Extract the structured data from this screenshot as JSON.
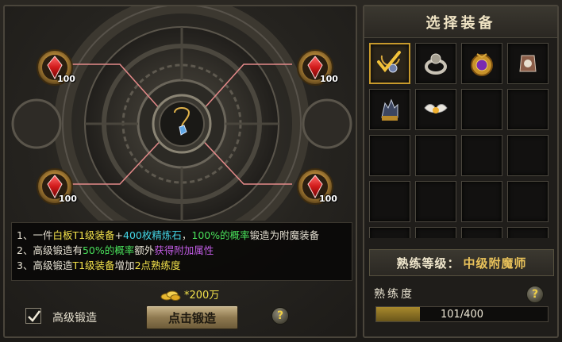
{
  "forge": {
    "slots": [
      {
        "id": "top-left",
        "count": "100"
      },
      {
        "id": "top-right",
        "count": "100"
      },
      {
        "id": "bottom-left",
        "count": "100"
      },
      {
        "id": "bottom-right",
        "count": "100"
      }
    ],
    "info": {
      "line1": {
        "prefix": "1、一件",
        "item": "白板T1级装备",
        "plus": "+",
        "stones": "400枚精炼石",
        "comma": "，",
        "rate": "100%的概率",
        "suffix": "锻造为附魔装备"
      },
      "line2": {
        "prefix": "2、高级锻造有",
        "rate": "50%的概率",
        "mid": "额外",
        "bonus": "获得附加属性"
      },
      "line3": {
        "prefix": "3、高级锻造",
        "item": "T1级装备",
        "mid": "增加",
        "points": "2点熟练度"
      }
    },
    "cost": "*200万",
    "advanced_label": "高级锻造",
    "advanced_checked": true,
    "forge_button": "点击锻造",
    "help_symbol": "?"
  },
  "equipment": {
    "title": "选择装备",
    "cells": [
      {
        "icon": "amulet-necklace-icon",
        "selected": true
      },
      {
        "icon": "ring-icon",
        "selected": false
      },
      {
        "icon": "gold-medallion-icon",
        "selected": false
      },
      {
        "icon": "bracer-icon",
        "selected": false
      },
      {
        "icon": "gauntlet-icon",
        "selected": false
      },
      {
        "icon": "winged-ring-icon",
        "selected": false
      },
      {
        "icon": "",
        "selected": false
      },
      {
        "icon": "",
        "selected": false
      },
      {
        "icon": "",
        "selected": false
      },
      {
        "icon": "",
        "selected": false
      },
      {
        "icon": "",
        "selected": false
      },
      {
        "icon": "",
        "selected": false
      },
      {
        "icon": "",
        "selected": false
      },
      {
        "icon": "",
        "selected": false
      },
      {
        "icon": "",
        "selected": false
      },
      {
        "icon": "",
        "selected": false
      },
      {
        "icon": "",
        "selected": false
      },
      {
        "icon": "",
        "selected": false
      },
      {
        "icon": "",
        "selected": false
      },
      {
        "icon": "",
        "selected": false
      }
    ]
  },
  "proficiency": {
    "level_label": "熟练等级：",
    "level_value": "中级附魔师",
    "label": "熟练度",
    "progress_text": "101/400",
    "current": 101,
    "max": 400,
    "help_symbol": "?"
  },
  "colors": {
    "accent_gold": "#c89a2c",
    "text_yellow": "#f3e24b",
    "text_cyan": "#44d6e6",
    "text_green": "#49e05a",
    "text_purple": "#c25ce6"
  }
}
